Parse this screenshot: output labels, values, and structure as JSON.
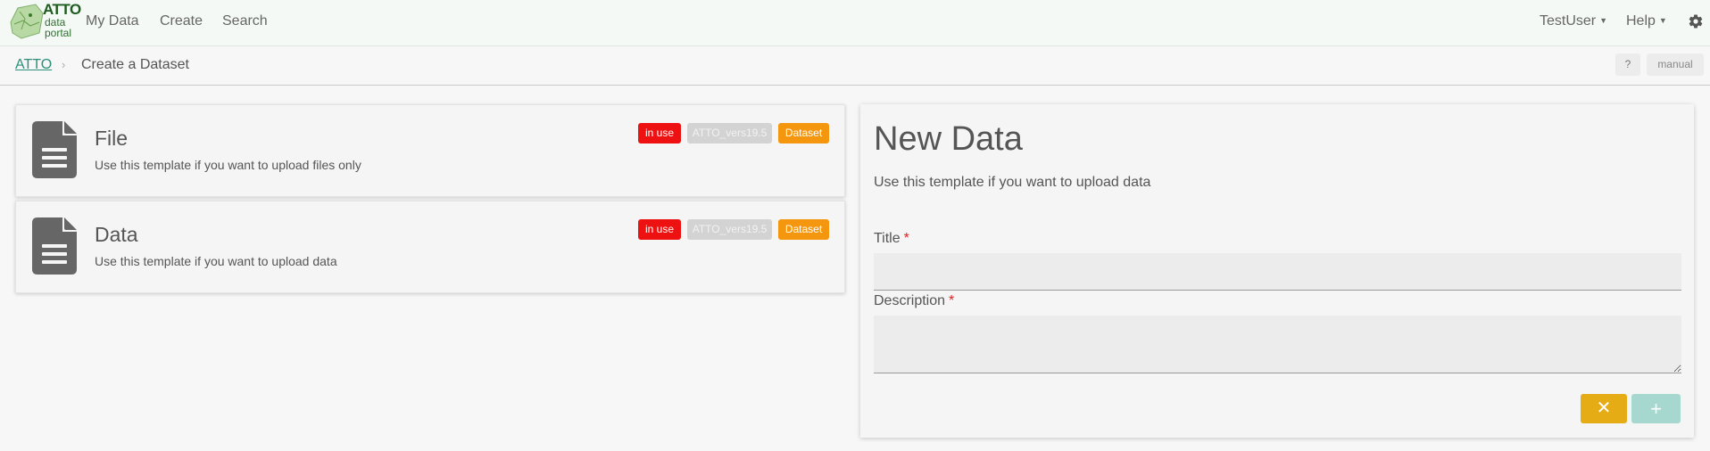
{
  "app": {
    "logo_title": "ATTO",
    "logo_sub_line1": "data",
    "logo_sub_line2": "portal",
    "accent_color": "#2b8f7a"
  },
  "nav": {
    "items": [
      {
        "label": "My Data"
      },
      {
        "label": "Create"
      },
      {
        "label": "Search"
      }
    ],
    "user_label": "TestUser",
    "help_label": "Help",
    "settings_icon": "gear-icon"
  },
  "breadcrumb": {
    "root": "ATTO",
    "separator": "›",
    "current": "Create a Dataset",
    "help_button": "?",
    "manual_button": "manual"
  },
  "templates": [
    {
      "title": "File",
      "description": "Use this template if you want to upload files only",
      "icon": "document-icon",
      "badges": {
        "status": "in use",
        "version": "ATTO_vers19.5",
        "type": "Dataset"
      }
    },
    {
      "title": "Data",
      "description": "Use this template if you want to upload data",
      "icon": "document-icon",
      "badges": {
        "status": "in use",
        "version": "ATTO_vers19.5",
        "type": "Dataset"
      }
    }
  ],
  "form": {
    "title": "New Data",
    "description": "Use this template if you want to upload data",
    "fields": {
      "title_label": "Title",
      "title_value": "",
      "description_label": "Description",
      "description_value": "",
      "required_marker": "*"
    },
    "cancel_icon": "✕",
    "add_icon": "+"
  },
  "colors": {
    "badge_in_use": "#ee1111",
    "badge_version": "#d3d3d3",
    "badge_dataset": "#f5960f",
    "cancel_button": "#e6ac16",
    "add_button": "#a6d8d0"
  }
}
